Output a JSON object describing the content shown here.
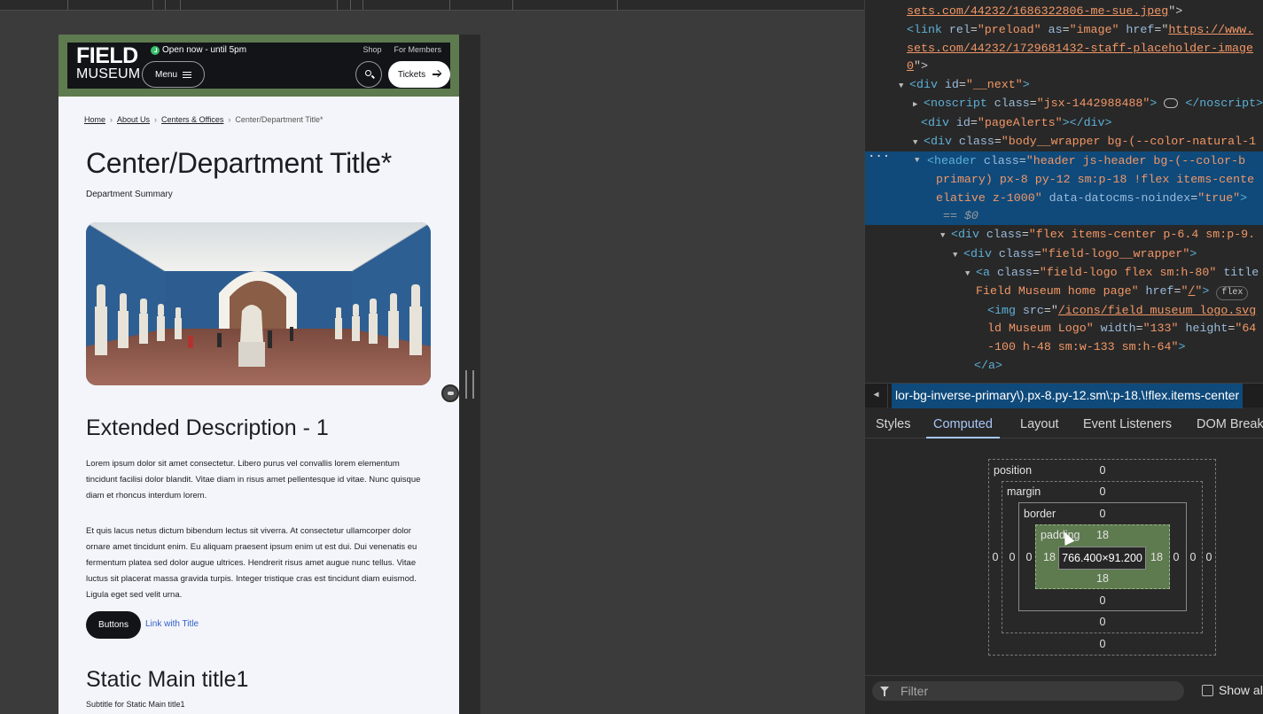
{
  "site": {
    "logo": {
      "line1": "FIELD",
      "line2": "MUSEUM"
    },
    "open_now": "Open now - until 5pm",
    "top_links": [
      "Shop",
      "For Members"
    ],
    "menu_label": "Menu",
    "tickets_label": "Tickets",
    "breadcrumb": {
      "items": [
        "Home",
        "About Us",
        "Centers & Offices"
      ],
      "current": "Center/Department Title*"
    },
    "page_title": "Center/Department Title*",
    "summary": "Department Summary",
    "hero_alt": "Gallery hall with white marble statues and blue walls",
    "extended_title": "Extended Description - 1",
    "para1": "Lorem ipsum dolor sit amet consectetur. Libero purus vel convallis lorem elementum tincidunt facilisi dolor blandit. Vitae diam in risus amet pellentesque id vitae. Nunc quisque diam et rhoncus interdum lorem.",
    "para2": "Et quis lacus netus dictum bibendum lectus sit viverra. At consectetur ullamcorper dolor ornare amet tincidunt enim. Eu aliquam praesent ipsum enim ut est dui. Dui venenatis eu fermentum platea sed dolor augue ultrices. Hendrerit risus amet augue nunc tellus. Vitae luctus sit placerat massa gravida turpis. Integer tristique cras est tincidunt diam euismod. Ligula eget sed velit urna.",
    "button_label": "Buttons",
    "link_label": "Link with Title",
    "static_title": "Static Main title1",
    "static_subtitle": "Subtitle for Static Main title1"
  },
  "devtools": {
    "dom_lines": {
      "l0_url": "sets.com/44232/1686322806-me-sue.jpeg",
      "l1_preload_href": "https://www.",
      "l2_url": "sets.com/44232/1729681432-staff-placeholder-image",
      "l3_tail": "0",
      "next_id": "__next",
      "noscript_class": "jsx-1442988488",
      "page_alerts_id": "pageAlerts",
      "body_class": "body__wrapper bg-(--color-natural-1",
      "header_class_1": "header js-header bg-(--color-b",
      "header_class_2": "primary) px-8 py-12 sm:p-18 !flex items-cente",
      "header_class_3": "elative z-1000",
      "noindex": "true",
      "dollar": "== $0",
      "flex_div_class": "flex items-center p-6.4 sm:p-9.",
      "logo_wrapper_class": "field-logo__wrapper",
      "logo_a_class": "field-logo flex sm:h-80",
      "logo_a_title": "Field Museum home page",
      "logo_a_href": "/",
      "flex_pill": "flex",
      "img_src": "/icons/field_museum_logo.svg",
      "img_alt_tail": "ld Museum Logo",
      "img_width": "133",
      "img_height": "64",
      "img_class_tail": "-100 h-48 sm:w-133 sm:h-64"
    },
    "breadcrumb_selector": "lor-bg-inverse-primary\\).px-8.py-12.sm\\:p-18.\\!flex.items-center",
    "tabs": [
      "Styles",
      "Computed",
      "Layout",
      "Event Listeners",
      "DOM Breakpoints"
    ],
    "active_tab": "Computed",
    "box_model": {
      "position_label": "position",
      "position": "0",
      "margin_label": "margin",
      "margin": "0",
      "border_label": "border",
      "border": "0",
      "padding_label": "padding",
      "padding": "18",
      "content_size": "766.400×91.200",
      "zero": "0",
      "eighteen": "18"
    },
    "filter_placeholder": "Filter",
    "show_all": "Show all"
  }
}
